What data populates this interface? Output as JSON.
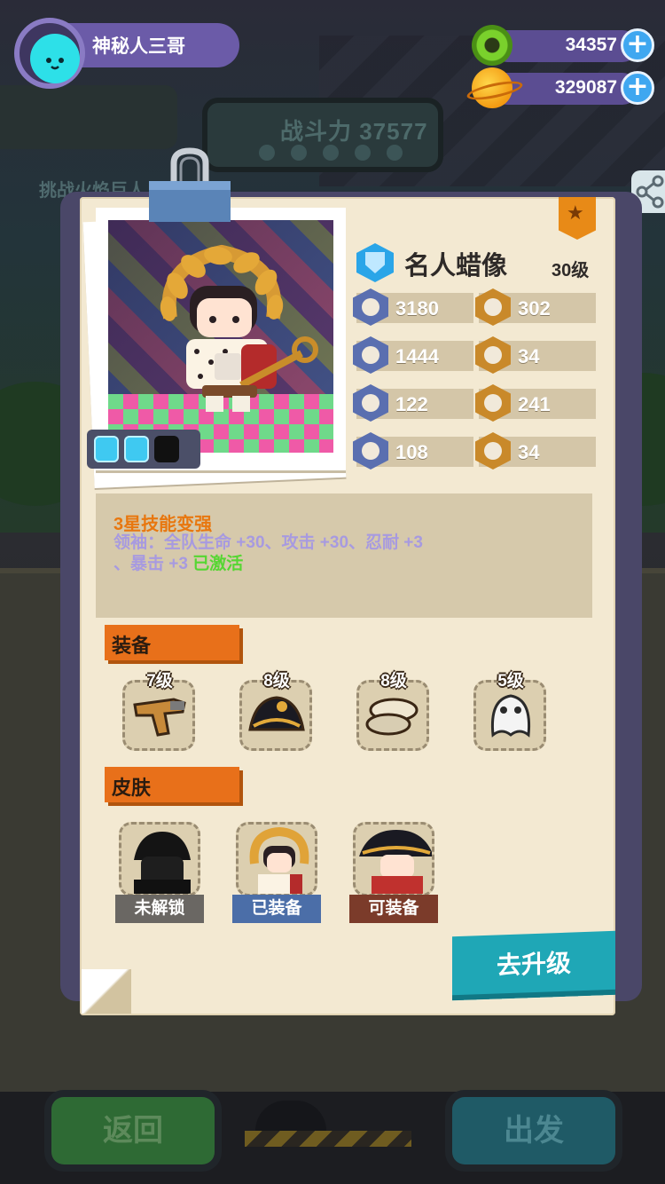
{
  "player": {
    "name": "神秘人三哥"
  },
  "currencies": [
    {
      "icon": "green-gem-coin-icon",
      "value": "34357"
    },
    {
      "icon": "orange-planet-coin-icon",
      "value": "329087"
    }
  ],
  "background": {
    "power_label": "战斗力 37577",
    "hint": "挑战火焰巨人"
  },
  "hero": {
    "name": "名人蜡像",
    "level": "30级",
    "energy": {
      "filled": 2,
      "total": 3
    },
    "stats_left": [
      {
        "icon": "heart-shield-icon",
        "value": "3180"
      },
      {
        "icon": "bell-icon",
        "value": "1444"
      },
      {
        "icon": "shield-icon",
        "value": "122"
      },
      {
        "icon": "anchor-icon",
        "value": "108"
      }
    ],
    "stats_right": [
      {
        "icon": "fist-icon",
        "value": "302"
      },
      {
        "icon": "smile-icon",
        "value": "34"
      },
      {
        "icon": "muscle-icon",
        "value": "241"
      },
      {
        "icon": "brain-icon",
        "value": "34"
      }
    ]
  },
  "skill": {
    "title": "3星技能变强",
    "desc_line1": "领袖：全队生命 +30、攻击 +30、忍耐 +3",
    "desc_line2": "、暴击 +3 ",
    "desc_status": "已激活"
  },
  "sections": {
    "equipment": "装备",
    "skins": "皮肤"
  },
  "equipment": [
    {
      "icon": "pistol-icon",
      "level": "7级"
    },
    {
      "icon": "bicorne-hat-icon",
      "level": "8级"
    },
    {
      "icon": "bone-icon",
      "level": "8级"
    },
    {
      "icon": "ghost-mask-icon",
      "level": "5级"
    }
  ],
  "skins": [
    {
      "icon": "dark-skin-icon",
      "label": "未解锁"
    },
    {
      "icon": "laurel-skin-icon",
      "label": "已装备"
    },
    {
      "icon": "napoleon-skin-icon",
      "label": "可装备"
    }
  ],
  "buttons": {
    "upgrade": "去升级",
    "back": "返回",
    "go": "出发"
  },
  "colors": {
    "accent_orange": "#e8701a",
    "upgrade_teal": "#1fa7b6",
    "skill_purple": "#a79ae0",
    "activated_green": "#55d632"
  }
}
